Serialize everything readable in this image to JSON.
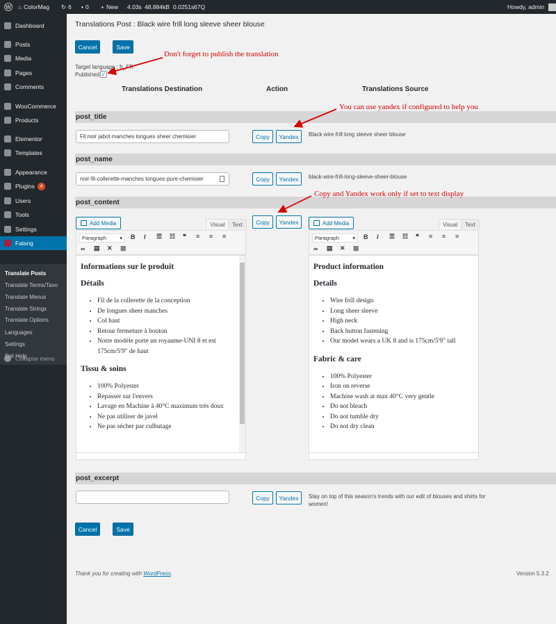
{
  "adminbar": {
    "site_name": "ColorMag",
    "updates": "6",
    "comments": "0",
    "new_label": "New",
    "stats": [
      "4.03s",
      "48,884kB",
      "0.0251s",
      "67Q"
    ],
    "howdy": "Howdy, admin"
  },
  "sidebar": {
    "items": [
      {
        "label": "Dashboard",
        "icon": "dashboard-icon"
      },
      {
        "label": "Posts",
        "icon": "pin-icon"
      },
      {
        "label": "Media",
        "icon": "media-icon"
      },
      {
        "label": "Pages",
        "icon": "pages-icon"
      },
      {
        "label": "Comments",
        "icon": "comments-icon"
      },
      {
        "label": "WooCommerce",
        "icon": "woocommerce-icon"
      },
      {
        "label": "Products",
        "icon": "products-icon"
      },
      {
        "label": "Elementor",
        "icon": "elementor-icon"
      },
      {
        "label": "Templates",
        "icon": "folder-icon"
      },
      {
        "label": "Appearance",
        "icon": "brush-icon"
      },
      {
        "label": "Plugins",
        "icon": "plugin-icon",
        "badge": "4"
      },
      {
        "label": "Users",
        "icon": "users-icon"
      },
      {
        "label": "Tools",
        "icon": "wrench-icon"
      },
      {
        "label": "Settings",
        "icon": "settings-icon"
      },
      {
        "label": "Falang",
        "icon": "flag-icon"
      }
    ],
    "sub_items": [
      "Translate Posts",
      "Translate Terms/Taxo",
      "Translate Menus",
      "Translate Strings",
      "Translate Options",
      "Languages",
      "Settings",
      "Get Help"
    ],
    "collapse": "Collapse menu"
  },
  "page": {
    "title": "Translations Post : Black wire frill long sleeve sheer blouse",
    "cancel": "Cancel",
    "save": "Save",
    "target_language": "Target language : fr_FR",
    "published": "Published",
    "col_destination": "Translations Destination",
    "col_action": "Action",
    "col_source": "Translations Source",
    "copy": "Copy",
    "yandex": "Yandex"
  },
  "annotations": {
    "publish": "Don't forget to publish the translation",
    "yandex": "You can use yandex if configured to help you",
    "text_display": "Copy and Yandex work only if set to text display"
  },
  "fields": {
    "post_title": {
      "label": "post_title",
      "value": "Fil noir jabot manches longues sheer chemisier",
      "source": "Black wire frill long sleeve sheer blouse"
    },
    "post_name": {
      "label": "post_name",
      "value": "noir-fil-collerette-manches longues-pure-chemisier",
      "source": "black-wire-frill-long-sleeve-sheer-blouse"
    },
    "post_content": {
      "label": "post_content"
    },
    "post_excerpt": {
      "label": "post_excerpt",
      "value": "",
      "source": "Stay on top of this season's trends with our edit of blouses and shirts for women!"
    }
  },
  "editor": {
    "add_media": "Add Media",
    "tab_visual": "Visual",
    "tab_text": "Text",
    "format": "Paragraph"
  },
  "dest_content": {
    "h1": "Informations sur le produit",
    "h2": "Détails",
    "list1": [
      "Fil de la collerette de la conception",
      "De longues sheer manches",
      "Col haut",
      "Retour fermeture à bouton",
      "Notre modèle porte un royaume-UNI 8 et est 175cm/5'9\" de haut"
    ],
    "h3": "Tissu & soins",
    "list2": [
      "100% Polyester",
      "Repasser sur l'envers",
      "Lavage en Machine à 40°C maximum très doux",
      "Ne pas utiliser de javel",
      "Ne pas sécher par culbutage"
    ]
  },
  "src_content": {
    "h1": "Product information",
    "h2": "Details",
    "list1": [
      "Wire frill design",
      "Long sheer sleeve",
      "High neck",
      "Back button fastening",
      "Our model wears a UK 8 and is 175cm/5'9\" tall"
    ],
    "h3": "Fabric & care",
    "list2": [
      "100% Polyester",
      "Iron on reverse",
      "Machine wash at max 40°C very gentle",
      "Do not bleach",
      "Do not tumble dry",
      "Do not dry clean"
    ]
  },
  "footer": {
    "thanks_prefix": "Thank you for creating with",
    "thanks_link": "WordPress",
    "thanks_suffix": ".",
    "version": "Version 5.3.2"
  },
  "colors": {
    "accent": "#0073aa",
    "annotation": "#d60000",
    "sidebar": "#23282d"
  }
}
